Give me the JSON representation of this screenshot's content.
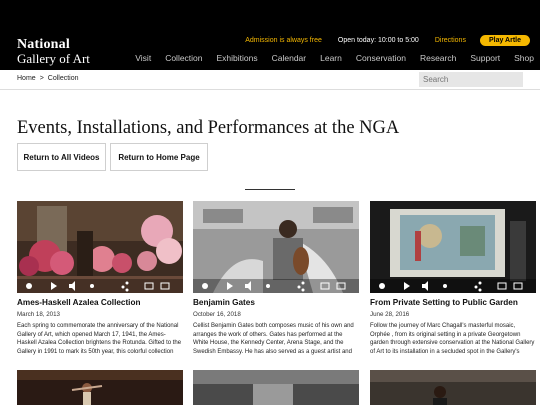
{
  "header": {
    "logo_line1": "National",
    "logo_line2": "Gallery of Art",
    "admission": "Admission is always free",
    "hours": "Open today: 10:00 to 5:00",
    "directions": "Directions",
    "play_button": "Play Artle",
    "nav": [
      "Visit",
      "Collection",
      "Exhibitions",
      "Calendar",
      "Learn",
      "Conservation",
      "Research",
      "Support",
      "Shop"
    ]
  },
  "breadcrumb": {
    "home": "Home",
    "separator": ">",
    "current": "Collection"
  },
  "search": {
    "placeholder": "Search"
  },
  "page": {
    "title": "Events, Installations, and Performances at the NGA",
    "button_all_videos": "Return to All Videos",
    "button_home": "Return to Home Page"
  },
  "videos": [
    {
      "title": "Ames-Haskell Azalea Collection",
      "date": "March 18, 2013",
      "description": "Each spring to commemorate the anniversary of the National Gallery of Art, which opened March 17, 1941, the Ames-Haskell Azalea Collection brightens the Rotunda. Gifted to the Gallery in 1991 to mark its 50th year, this colorful collection o..."
    },
    {
      "title": "Benjamin Gates",
      "date": "October 16, 2018",
      "description": "Cellist Benjamin Gates both composes music of his own and arranges the work of others. Gates has performed at the White House, the Kennedy Center, Arena Stage, and the Swedish Embassy. He has also served as a guest artist and teacher a..."
    },
    {
      "title": "From Private Setting to Public Garden",
      "date": "June 28, 2016",
      "description": "Follow the journey of Marc Chagall's masterful mosaic, Orphée , from its original setting in a private Georgetown garden through extensive conservation at the National Gallery of Art to its installation in a secluded spot in the Gallery's Sculpture..."
    }
  ],
  "colors": {
    "accent": "#f5b800",
    "header_bg": "#000000"
  }
}
